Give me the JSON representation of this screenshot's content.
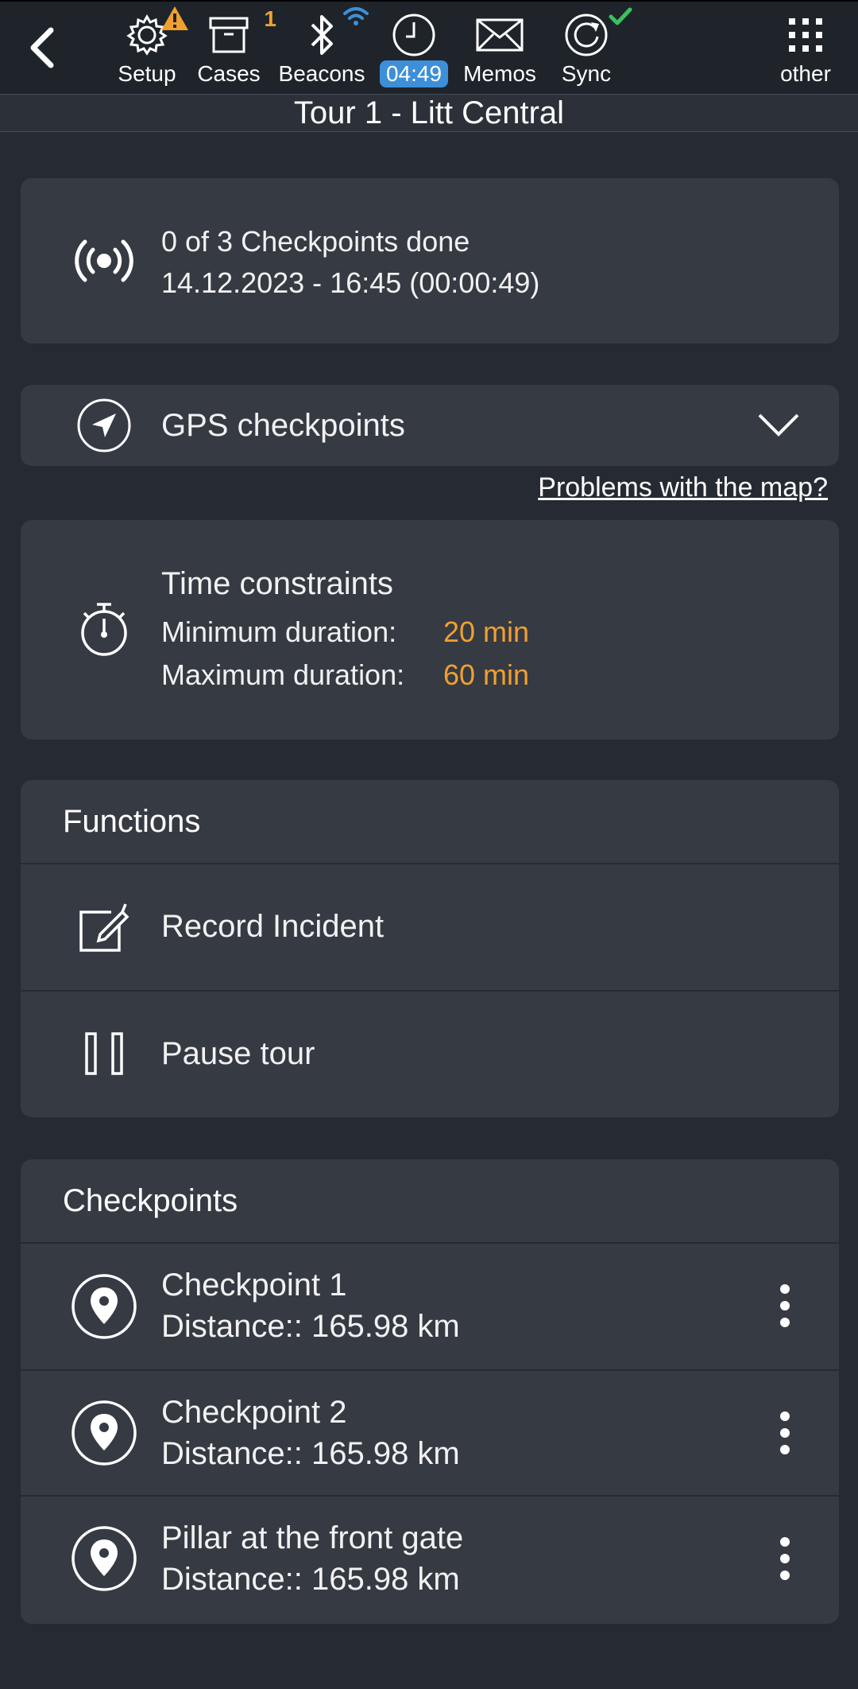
{
  "toolbar": {
    "items": [
      {
        "id": "setup",
        "label": "Setup",
        "icon": "gear-icon",
        "badge": "warning-icon"
      },
      {
        "id": "cases",
        "label": "Cases",
        "icon": "archive-box-icon",
        "badge": "1"
      },
      {
        "id": "beacons",
        "label": "Beacons",
        "icon": "bluetooth-icon",
        "badge": "wifi-icon"
      },
      {
        "id": "clock",
        "label": "04:49",
        "icon": "clock-icon"
      },
      {
        "id": "memos",
        "label": "Memos",
        "icon": "envelope-icon"
      },
      {
        "id": "sync",
        "label": "Sync",
        "icon": "sync-icon",
        "badge": "check-icon"
      },
      {
        "id": "other",
        "label": "other",
        "icon": "grid-icon"
      }
    ],
    "colors": {
      "warn": "#f0a030",
      "wifi": "#3d8fd8",
      "check": "#3cc060",
      "clock_pill": "#3d8fd8"
    }
  },
  "title": "Tour 1 - Litt Central",
  "status": {
    "icon": "broadcast-icon",
    "checkpoints_done": "0 of 3 Checkpoints done",
    "datetime": "14.12.2023 - 16:45 (00:00:49)"
  },
  "gps": {
    "icon": "navigation-arrow-icon",
    "label": "GPS checkpoints",
    "map_problems_link": "Problems with the map?"
  },
  "time_constraints": {
    "icon": "stopwatch-icon",
    "title": "Time constraints",
    "min_label": "Minimum duration:",
    "min_value": "20 min",
    "max_label": "Maximum duration:",
    "max_value": "60 min",
    "value_color": "#f0a030"
  },
  "functions": {
    "header": "Functions",
    "items": [
      {
        "label": "Record Incident",
        "icon": "edit-note-icon"
      },
      {
        "label": "Pause tour",
        "icon": "pause-icon"
      }
    ]
  },
  "checkpoints": {
    "header": "Checkpoints",
    "items": [
      {
        "name": "Checkpoint 1",
        "distance": "Distance:: 165.98 km"
      },
      {
        "name": "Checkpoint 2",
        "distance": "Distance:: 165.98 km"
      },
      {
        "name": "Pillar at the front gate",
        "distance": "Distance:: 165.98 km"
      }
    ]
  }
}
